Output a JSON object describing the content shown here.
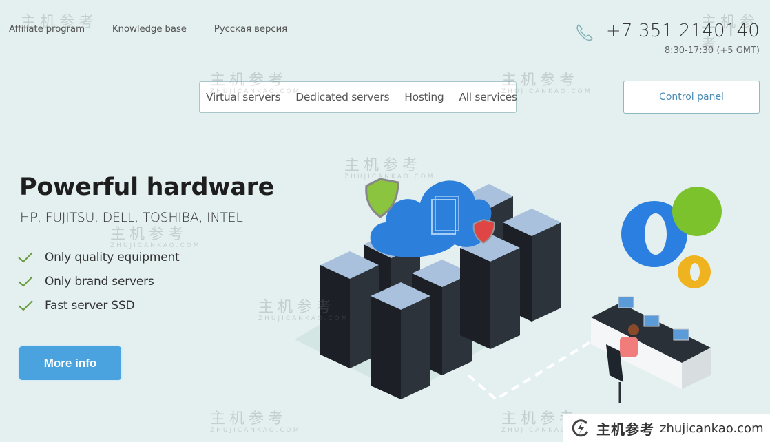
{
  "top_links": [
    {
      "label": "Affiliate program"
    },
    {
      "label": "Knowledge base"
    },
    {
      "label": "Русская версия"
    }
  ],
  "contact": {
    "phone_icon": "phone-icon",
    "phone": "+7 351 2140140",
    "hours": "8:30-17:30 (+5 GMT)"
  },
  "nav": {
    "items": [
      {
        "label": "Virtual servers"
      },
      {
        "label": "Dedicated servers"
      },
      {
        "label": "Hosting"
      },
      {
        "label": "All services"
      }
    ],
    "control_panel": "Control panel"
  },
  "hero": {
    "title": "Powerful hardware",
    "subtitle": "HP, FUJITSU, DELL, TOSHIBA, INTEL",
    "features": [
      {
        "icon": "check-icon",
        "text": "Only quality equipment"
      },
      {
        "icon": "check-icon",
        "text": "Only brand servers"
      },
      {
        "icon": "check-icon",
        "text": "Fast server SSD"
      }
    ],
    "cta": "More info"
  },
  "watermark": {
    "cn": "主机参考",
    "en": "ZHUJICANKAO.COM",
    "badge_cn": "主机参考",
    "badge_url": "zhujicankao.com"
  },
  "colors": {
    "background": "#e4f0f0",
    "accent": "#4aa3de",
    "check": "#6a9a3a",
    "link": "#4b8db5"
  }
}
